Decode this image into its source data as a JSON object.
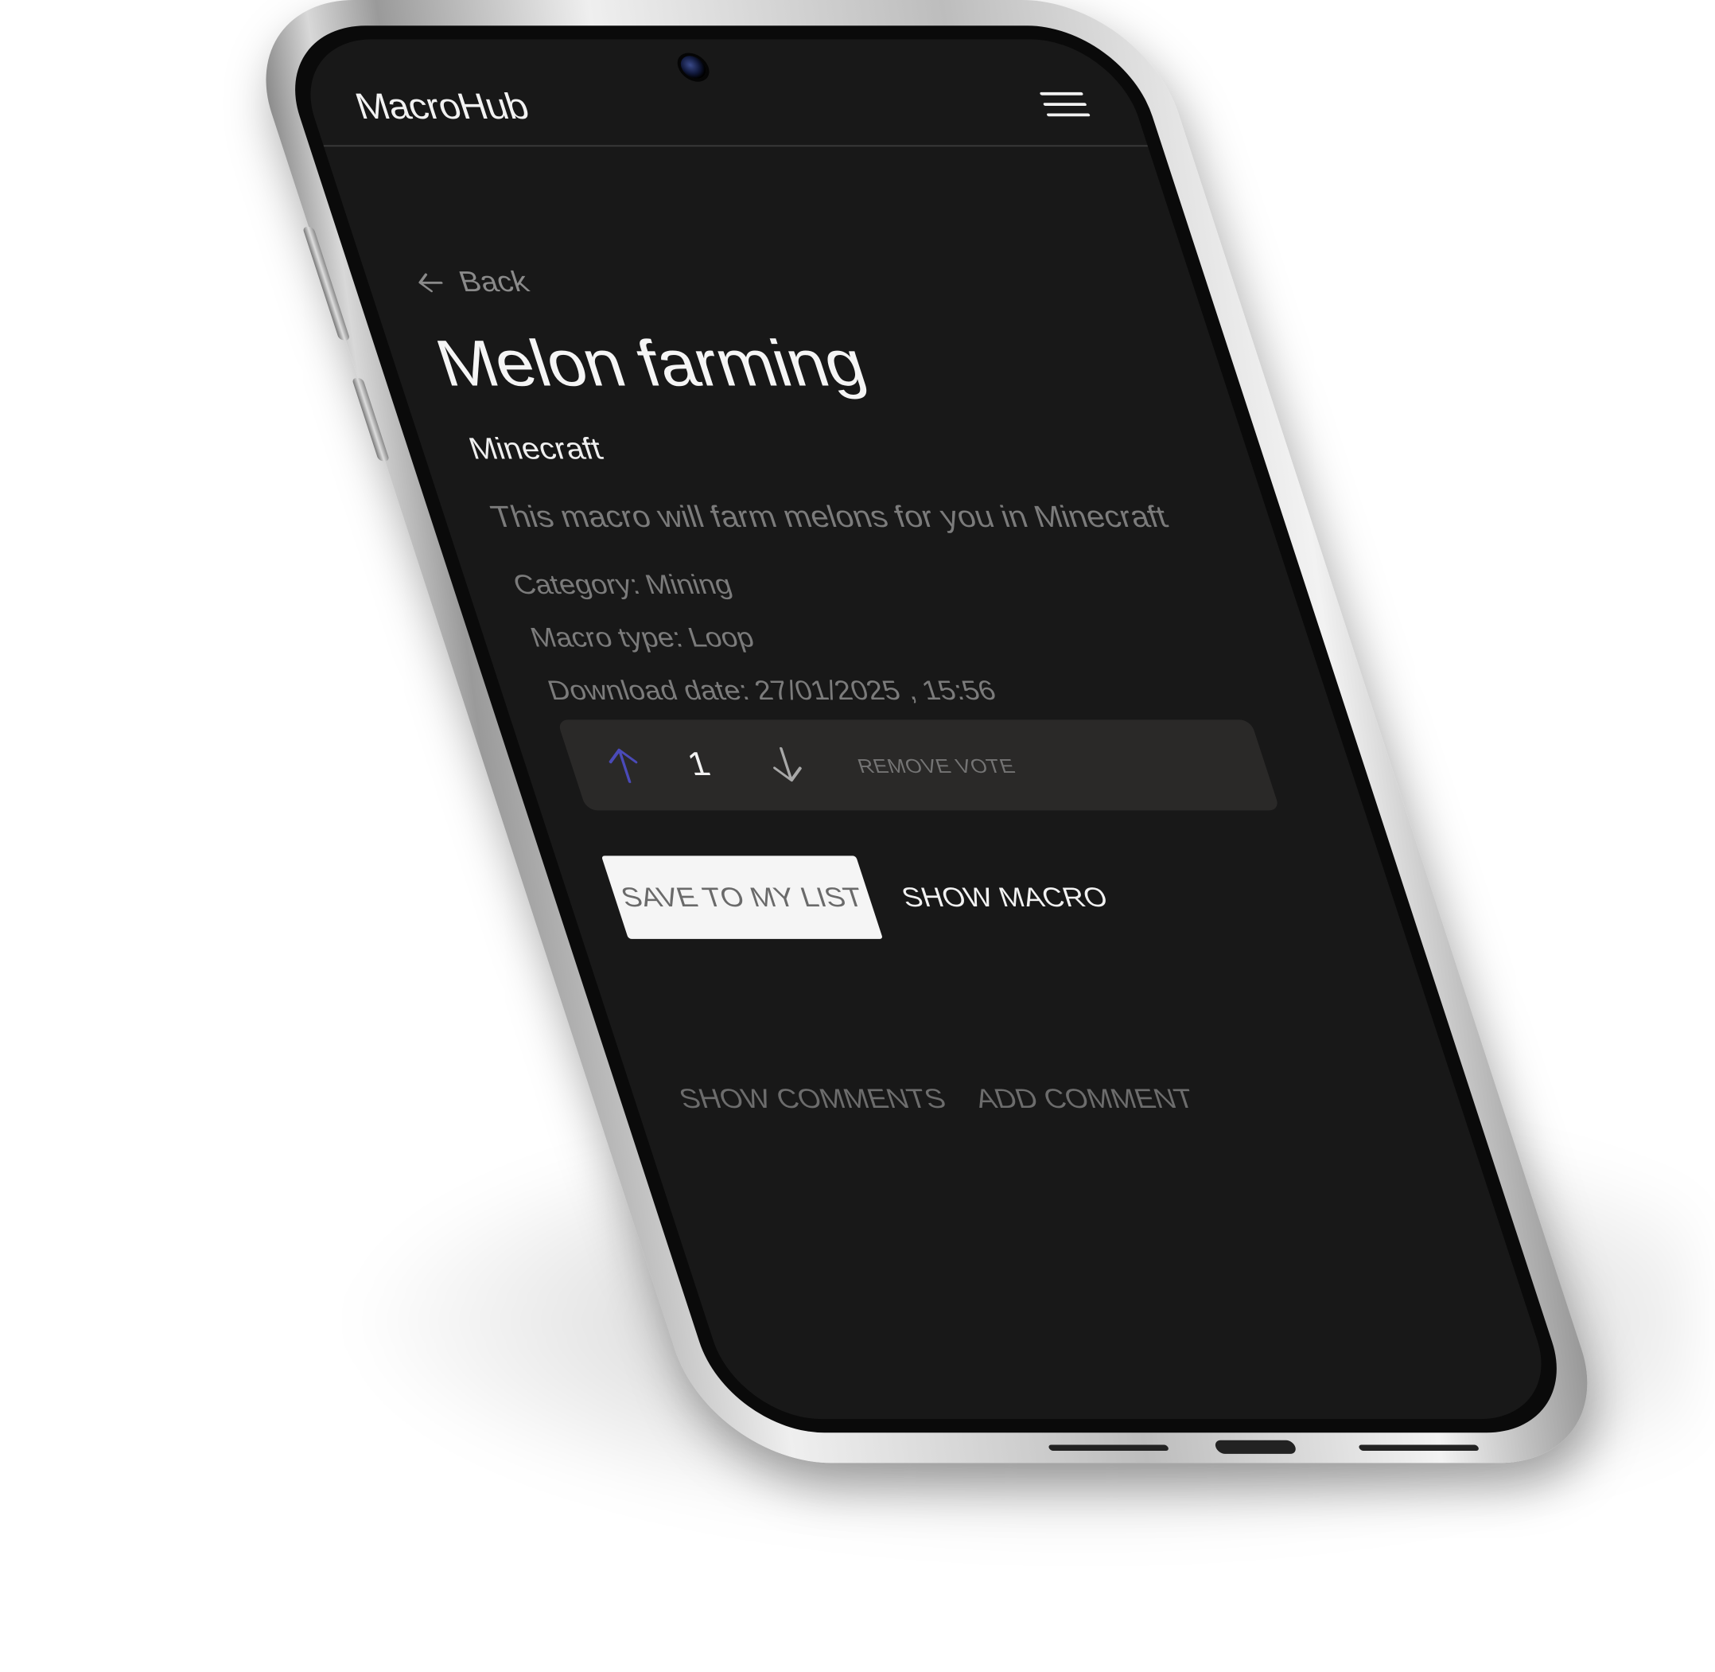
{
  "app": {
    "name": "MacroHub"
  },
  "nav": {
    "back_label": "Back"
  },
  "macro": {
    "title": "Melon farming",
    "game": "Minecraft",
    "description": "This macro will farm melons for you in Minecraft",
    "category": "Category: Mining",
    "macro_type": "Macro type: Loop",
    "download_date": "Download date: 27/01/2025 , 15:56"
  },
  "votes": {
    "count": "1",
    "remove_label": "REMOVE VOTE",
    "upvote_color": "#4a4ab8"
  },
  "actions": {
    "save_label": "SAVE TO MY LIST",
    "show_macro_label": "SHOW MACRO"
  },
  "comments": {
    "show_label": "SHOW COMMENTS",
    "add_label": "ADD COMMENT"
  }
}
